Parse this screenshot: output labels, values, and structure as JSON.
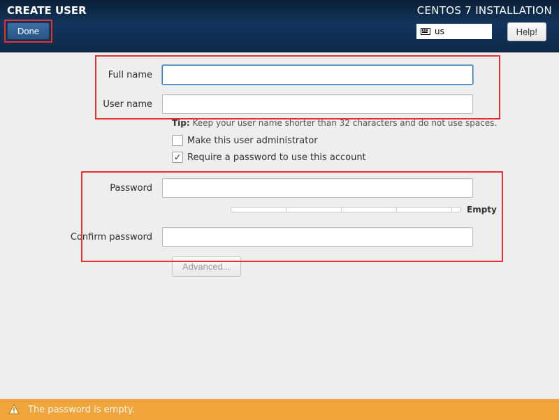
{
  "header": {
    "title": "CREATE USER",
    "product": "CENTOS 7 INSTALLATION",
    "done_label": "Done",
    "help_label": "Help!",
    "keyboard_layout": "us"
  },
  "form": {
    "full_name_label": "Full name",
    "full_name_value": "",
    "user_name_label": "User name",
    "user_name_value": "",
    "tip_prefix": "Tip:",
    "tip_text": " Keep your user name shorter than 32 characters and do not use spaces.",
    "admin_checkbox_label": "Make this user administrator",
    "admin_checked": false,
    "require_pw_label": "Require a password to use this account",
    "require_pw_checked": true,
    "password_label": "Password",
    "password_value": "",
    "strength_label": "Empty",
    "confirm_label": "Confirm password",
    "confirm_value": "",
    "advanced_label": "Advanced..."
  },
  "footer": {
    "warning_text": "The password is empty."
  }
}
